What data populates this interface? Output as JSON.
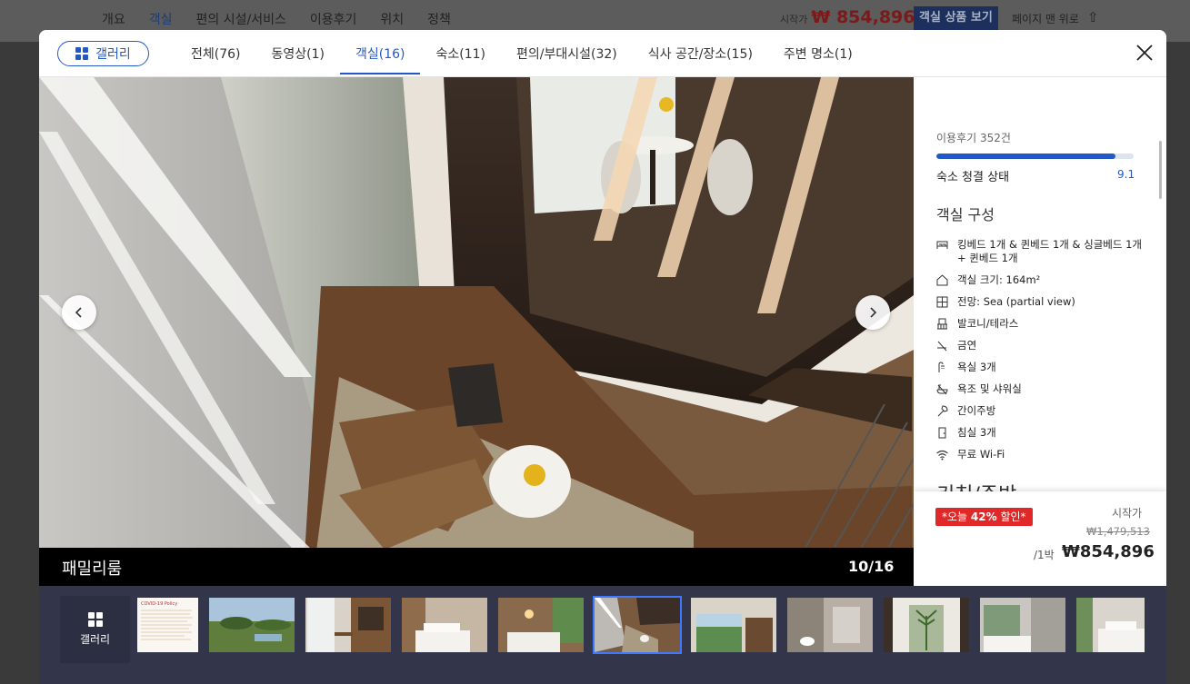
{
  "background_page": {
    "nav_items": [
      "개요",
      "객실",
      "편의 시설/서비스",
      "이용후기",
      "위치",
      "정책"
    ],
    "active_nav_index": 1,
    "price_label": "시작가",
    "price_value": "₩ 854,896",
    "cta_label": "객실 상품 보기",
    "to_top_label": "페이지 맨 위로"
  },
  "modal": {
    "gallery_button_label": "갤러리",
    "tabs": [
      {
        "label": "전체(76)",
        "active": false
      },
      {
        "label": "동영상(1)",
        "active": false
      },
      {
        "label": "객실(16)",
        "active": true
      },
      {
        "label": "숙소(11)",
        "active": false
      },
      {
        "label": "편의/부대시설(32)",
        "active": false
      },
      {
        "label": "식사 공간/장소(15)",
        "active": false
      },
      {
        "label": "주변 명소(1)",
        "active": false
      }
    ],
    "close_icon": "close-icon"
  },
  "viewer": {
    "room_name": "패밀리룸",
    "counter": "10/16"
  },
  "side_panel": {
    "review_count": "이용후기 352건",
    "score_label": "숙소 청결 상태",
    "score_value": "9.1",
    "score_fraction": 0.91,
    "section_title": "객실 구성",
    "amenities": [
      {
        "icon": "bed-icon",
        "text": "킹베드 1개 & 퀸베드 1개 & 싱글베드 1개 + 퀸베드 1개"
      },
      {
        "icon": "house-icon",
        "text": "객실 크기: 164m²"
      },
      {
        "icon": "window-view-icon",
        "text": "전망: Sea (partial view)"
      },
      {
        "icon": "balcony-icon",
        "text": "발코니/테라스"
      },
      {
        "icon": "no-smoking-icon",
        "text": "금연"
      },
      {
        "icon": "shower-icon",
        "text": "욕실 3개"
      },
      {
        "icon": "bathtub-icon",
        "text": "욕조 및 샤워실"
      },
      {
        "icon": "kitchen-icon",
        "text": "간이주방"
      },
      {
        "icon": "door-icon",
        "text": "침실 3개"
      },
      {
        "icon": "wifi-icon",
        "text": "무료 Wi-Fi"
      }
    ],
    "next_section_title": "키친/주방"
  },
  "price_box": {
    "badge_prefix": "*오늘 ",
    "badge_percent": "42%",
    "badge_suffix": " 할인*",
    "start_label": "시작가",
    "original_price": "₩1,479,513",
    "per_night": "/1박",
    "final_price": "₩854,896"
  },
  "thumbnails": {
    "gallery_label": "갤러리",
    "active_index": 5,
    "thumb_label": "COVID-19 Policy",
    "items": [
      {
        "kind": "policy-doc"
      },
      {
        "kind": "garden-view"
      },
      {
        "kind": "room-desk"
      },
      {
        "kind": "bedroom"
      },
      {
        "kind": "bedroom-lamp"
      },
      {
        "kind": "living-room-loft"
      },
      {
        "kind": "window-view"
      },
      {
        "kind": "bathroom"
      },
      {
        "kind": "courtyard"
      },
      {
        "kind": "bathtub-window"
      },
      {
        "kind": "bedroom-bright"
      }
    ]
  },
  "colors": {
    "accent": "#2458c9",
    "discount": "#e12828",
    "thumb_bar": "#33364a",
    "active_thumb_outline": "#3d78ff"
  }
}
